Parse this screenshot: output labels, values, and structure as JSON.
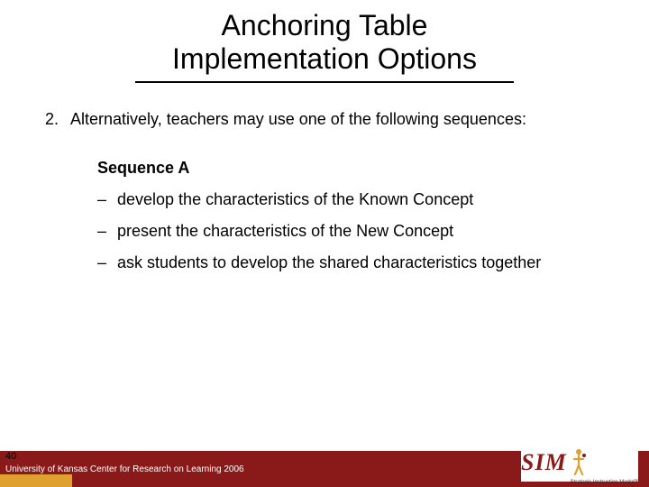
{
  "title_line1": "Anchoring Table",
  "title_line2": "Implementation Options",
  "intro": {
    "number": "2.",
    "text": "Alternatively, teachers may use one of the following sequences:"
  },
  "sequence": {
    "heading": "Sequence A",
    "items": [
      "develop the characteristics of the Known Concept",
      "present the characteristics of the New Concept",
      "ask students to develop the shared characteristics together"
    ]
  },
  "footer": {
    "slide_number": "40",
    "attribution": "University of Kansas Center for Research on Learning  2006",
    "logo_text": "SIM",
    "logo_subtitle": "Strategic Instruction Model®"
  }
}
